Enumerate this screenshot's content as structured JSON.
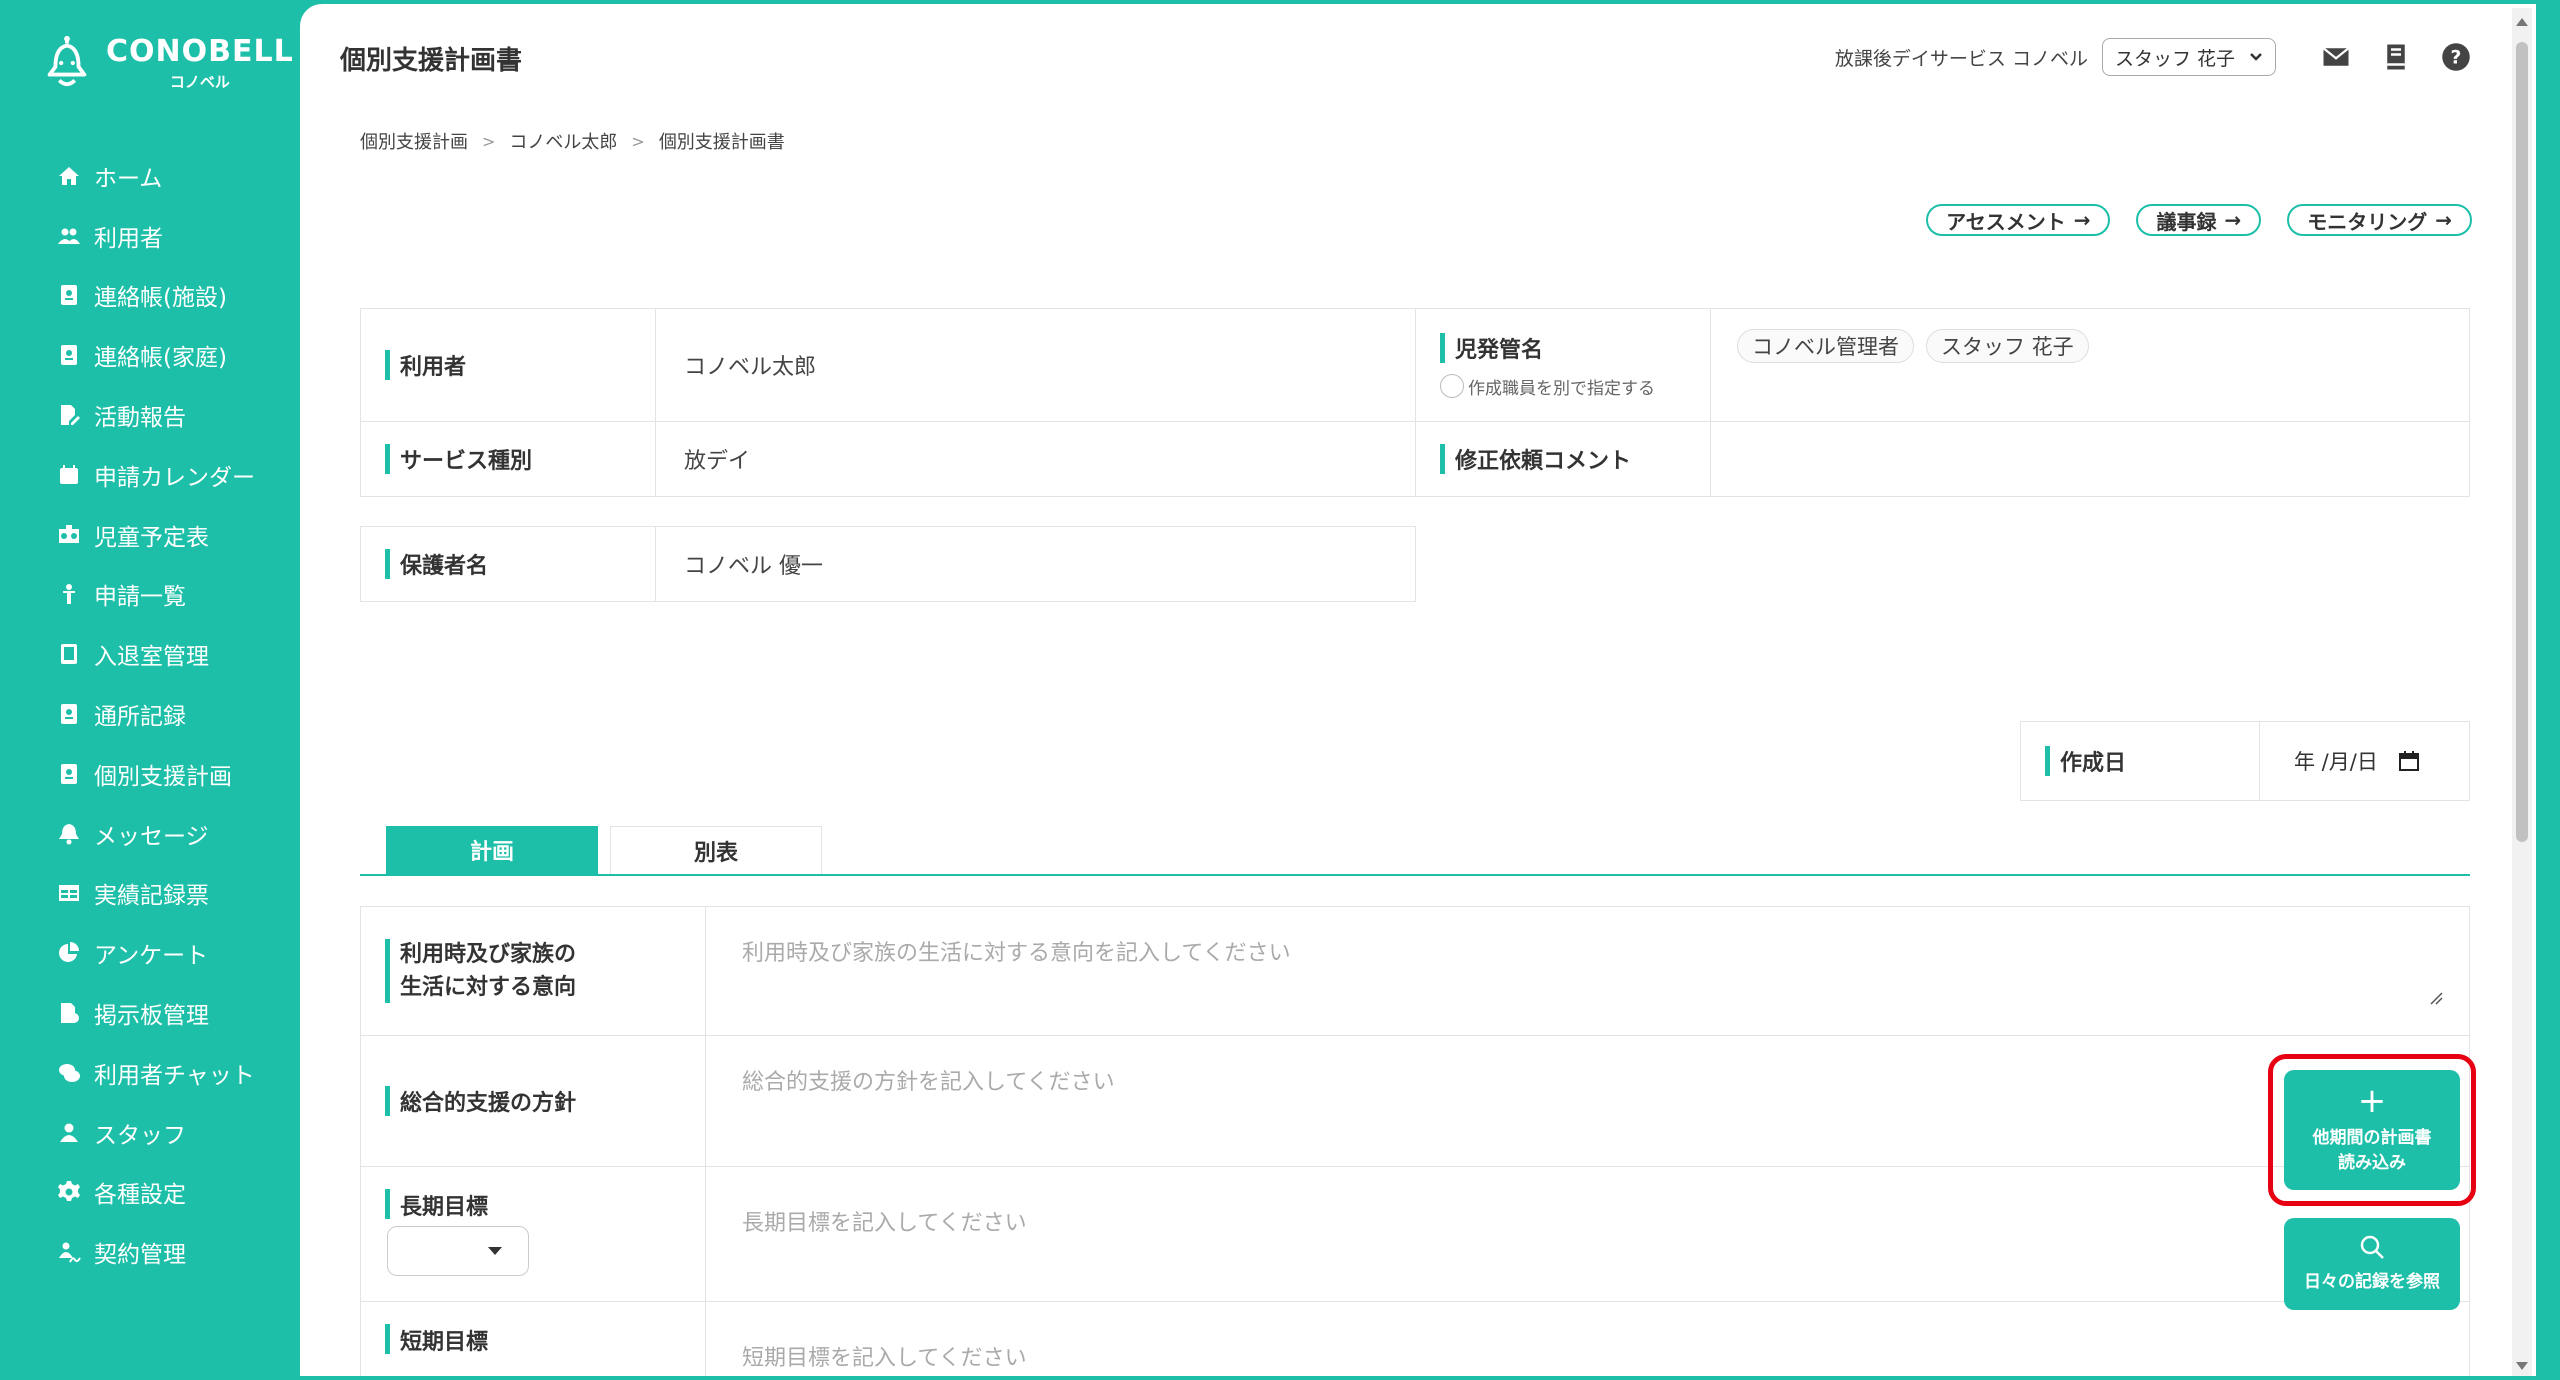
{
  "app": {
    "logo_text": "CONOBELL",
    "logo_sub": "コノベル"
  },
  "sidebar": {
    "items": [
      {
        "label": "ホーム",
        "icon": "home-icon"
      },
      {
        "label": "利用者",
        "icon": "users-icon"
      },
      {
        "label": "連絡帳(施設)",
        "icon": "contact-book-icon"
      },
      {
        "label": "連絡帳(家庭)",
        "icon": "contact-book-icon"
      },
      {
        "label": "活動報告",
        "icon": "report-edit-icon"
      },
      {
        "label": "申請カレンダー",
        "icon": "calendar-icon"
      },
      {
        "label": "児童予定表",
        "icon": "schedule-icon"
      },
      {
        "label": "申請一覧",
        "icon": "child-icon"
      },
      {
        "label": "入退室管理",
        "icon": "tablet-icon"
      },
      {
        "label": "通所記録",
        "icon": "record-icon"
      },
      {
        "label": "個別支援計画",
        "icon": "plan-icon"
      },
      {
        "label": "メッセージ",
        "icon": "bell-icon"
      },
      {
        "label": "実績記録票",
        "icon": "table-icon"
      },
      {
        "label": "アンケート",
        "icon": "pie-chart-icon"
      },
      {
        "label": "掲示板管理",
        "icon": "board-icon"
      },
      {
        "label": "利用者チャット",
        "icon": "chat-icon"
      },
      {
        "label": "スタッフ",
        "icon": "staff-icon"
      },
      {
        "label": "各種設定",
        "icon": "gear-icon"
      },
      {
        "label": "契約管理",
        "icon": "contract-icon"
      }
    ]
  },
  "header": {
    "title": "個別支援計画書",
    "facility": "放課後デイサービス コノベル",
    "staff": "スタッフ 花子"
  },
  "breadcrumb": [
    "個別支援計画",
    "コノベル太郎",
    "個別支援計画書"
  ],
  "nav_pills": [
    "アセスメント",
    "議事録",
    "モニタリング"
  ],
  "info": {
    "user_label": "利用者",
    "user_value": "コノベル太郎",
    "manager_label": "児発管名",
    "manager_option": "作成職員を別で指定する",
    "manager_tags": [
      "コノベル管理者",
      "スタッフ 花子"
    ],
    "service_label": "サービス種別",
    "service_value": "放デイ",
    "revision_label": "修正依頼コメント",
    "guardian_label": "保護者名",
    "guardian_value": "コノベル 優一",
    "created_label": "作成日",
    "created_value": "年 /月/日"
  },
  "tabs": [
    "計画",
    "別表"
  ],
  "form": {
    "intent_label_1": "利用時及び家族の",
    "intent_label_2": "生活に対する意向",
    "intent_placeholder": "利用時及び家族の生活に対する意向を記入してください",
    "policy_label": "総合的支援の方針",
    "policy_placeholder": "総合的支援の方針を記入してください",
    "long_label": "長期目標",
    "long_placeholder": "長期目標を記入してください",
    "short_label": "短期目標",
    "short_placeholder": "短期目標を記入してください"
  },
  "actions": {
    "import_line1": "他期間の計画書",
    "import_line2": "読み込み",
    "daily_records": "日々の記録を参照"
  },
  "colors": {
    "accent": "#1dbfa8",
    "highlight": "#e60012"
  }
}
